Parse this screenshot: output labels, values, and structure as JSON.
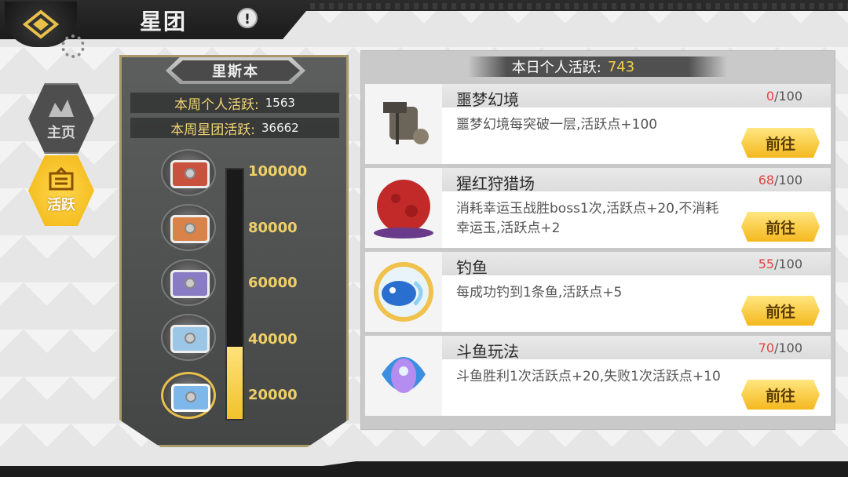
{
  "header": {
    "title": "星团",
    "info_symbol": "!"
  },
  "nav": [
    {
      "label": "主页",
      "icon": "home-icon"
    },
    {
      "label": "活跃",
      "icon": "activity-board-icon"
    }
  ],
  "panel": {
    "banner": "里斯本",
    "weekly_personal_label": "本周个人活跃:",
    "weekly_personal_value": "1563",
    "weekly_group_label": "本周星团活跃:",
    "weekly_group_value": "36662",
    "ticks": [
      "100000",
      "80000",
      "60000",
      "40000",
      "20000"
    ],
    "progress_fraction": 0.29
  },
  "list": {
    "header_label": "本日个人活跃:",
    "header_value": "743",
    "go_label": "前往",
    "tasks": [
      {
        "title": "噩梦幻境",
        "cur": "0",
        "max": "/100",
        "desc": "噩梦幻境每突破一层,活跃点+100"
      },
      {
        "title": "猩红狩猎场",
        "cur": "68",
        "max": "/100",
        "desc": "消耗幸运玉战胜boss1次,活跃点+20,不消耗幸运玉,活跃点+2"
      },
      {
        "title": "钓鱼",
        "cur": "55",
        "max": "/100",
        "desc": "每成功钓到1条鱼,活跃点+5"
      },
      {
        "title": "斗鱼玩法",
        "cur": "70",
        "max": "/100",
        "desc": "斗鱼胜利1次活跃点+20,失败1次活跃点+10"
      }
    ]
  },
  "colors": {
    "accent": "#f4b81e",
    "progress_red": "#e04444",
    "gold_text": "#f0cf68"
  }
}
